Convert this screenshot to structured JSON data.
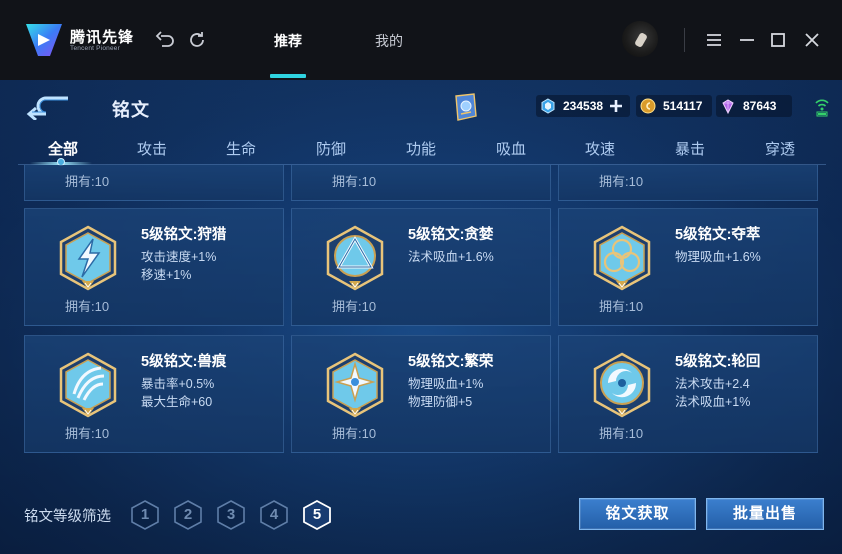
{
  "app": {
    "logo_title": "腾讯先锋",
    "logo_subtitle": "Tencent Pioneer",
    "nav_tabs": [
      {
        "label": "推荐",
        "active": true
      },
      {
        "label": "我的",
        "active": false
      }
    ]
  },
  "game": {
    "title": "铭文",
    "currencies": [
      {
        "name": "diamond-ticket",
        "value": "234538"
      },
      {
        "name": "gold-coin",
        "value": "514117"
      },
      {
        "name": "gem",
        "value": "87643"
      }
    ],
    "categories": [
      {
        "label": "全部",
        "active": true
      },
      {
        "label": "攻击",
        "active": false
      },
      {
        "label": "生命",
        "active": false
      },
      {
        "label": "防御",
        "active": false
      },
      {
        "label": "功能",
        "active": false
      },
      {
        "label": "吸血",
        "active": false
      },
      {
        "label": "攻速",
        "active": false
      },
      {
        "label": "暴击",
        "active": false
      },
      {
        "label": "穿透",
        "active": false
      }
    ],
    "partial_row": [
      {
        "owned": "拥有:10"
      },
      {
        "owned": "拥有:10"
      },
      {
        "owned": "拥有:10"
      }
    ],
    "runes": [
      {
        "name": "5级铭文:狩猎",
        "stats": [
          "攻击速度+1%",
          "移速+1%"
        ],
        "owned": "拥有:10",
        "icon": "lightning-rune-icon"
      },
      {
        "name": "5级铭文:贪婪",
        "stats": [
          "法术吸血+1.6%"
        ],
        "owned": "拥有:10",
        "icon": "triangle-rune-icon"
      },
      {
        "name": "5级铭文:夺萃",
        "stats": [
          "物理吸血+1.6%"
        ],
        "owned": "拥有:10",
        "icon": "knot-rune-icon"
      },
      {
        "name": "5级铭文:兽痕",
        "stats": [
          "暴击率+0.5%",
          "最大生命+60"
        ],
        "owned": "拥有:10",
        "icon": "claw-rune-icon"
      },
      {
        "name": "5级铭文:繁荣",
        "stats": [
          "物理吸血+1%",
          "物理防御+5"
        ],
        "owned": "拥有:10",
        "icon": "star-rune-icon"
      },
      {
        "name": "5级铭文:轮回",
        "stats": [
          "法术攻击+2.4",
          "法术吸血+1%"
        ],
        "owned": "拥有:10",
        "icon": "swirl-rune-icon"
      }
    ],
    "filter": {
      "label": "铭文等级筛选",
      "levels": [
        "1",
        "2",
        "3",
        "4",
        "5"
      ],
      "selected": "5"
    },
    "buttons": {
      "acquire": "铭文获取",
      "bulk_sell": "批量出售"
    }
  },
  "colors": {
    "accent": "#2fd3e0",
    "panel": "#1a4276",
    "background": "#143c73"
  }
}
